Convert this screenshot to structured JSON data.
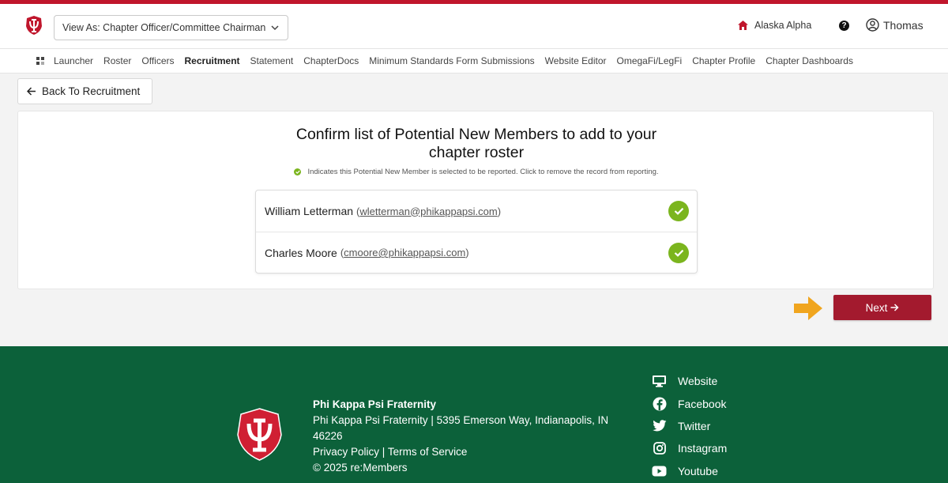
{
  "header": {
    "view_as": "View As: Chapter Officer/Committee Chairman",
    "chapter": "Alaska Alpha",
    "help": "?",
    "user": "Thomas"
  },
  "nav": {
    "items": [
      "Launcher",
      "Roster",
      "Officers",
      "Recruitment",
      "Statement",
      "ChapterDocs",
      "Minimum Standards Form Submissions",
      "Website Editor",
      "OmegaFi/LegFi",
      "Chapter Profile",
      "Chapter Dashboards"
    ],
    "active": "Recruitment"
  },
  "back_button": "Back To Recruitment",
  "card": {
    "title_line1": "Confirm list of Potential New Members to add to your",
    "title_line2": "chapter roster",
    "hint": "Indicates this Potential New Member is selected to be reported. Click to remove the record from reporting.",
    "members": [
      {
        "name": "William Letterman",
        "email": "wletterman@phikappapsi.com",
        "selected": true
      },
      {
        "name": "Charles Moore",
        "email": "cmoore@phikappapsi.com",
        "selected": true
      }
    ]
  },
  "next_button": "Next",
  "footer": {
    "org": "Phi Kappa Psi Fraternity",
    "address": "Phi Kappa Psi Fraternity | 5395 Emerson Way, Indianapolis, IN 46226",
    "privacy": "Privacy Policy",
    "sep": "|",
    "terms": "Terms of Service",
    "copyright": "© 2025 re:Members",
    "social": [
      "Website",
      "Facebook",
      "Twitter",
      "Instagram",
      "Youtube"
    ]
  },
  "colors": {
    "brand_red": "#c0162c",
    "button_red": "#a31a2e",
    "footer_green": "#0c613a",
    "check_green": "#7bb51e",
    "arrow_orange": "#f0a51e"
  }
}
